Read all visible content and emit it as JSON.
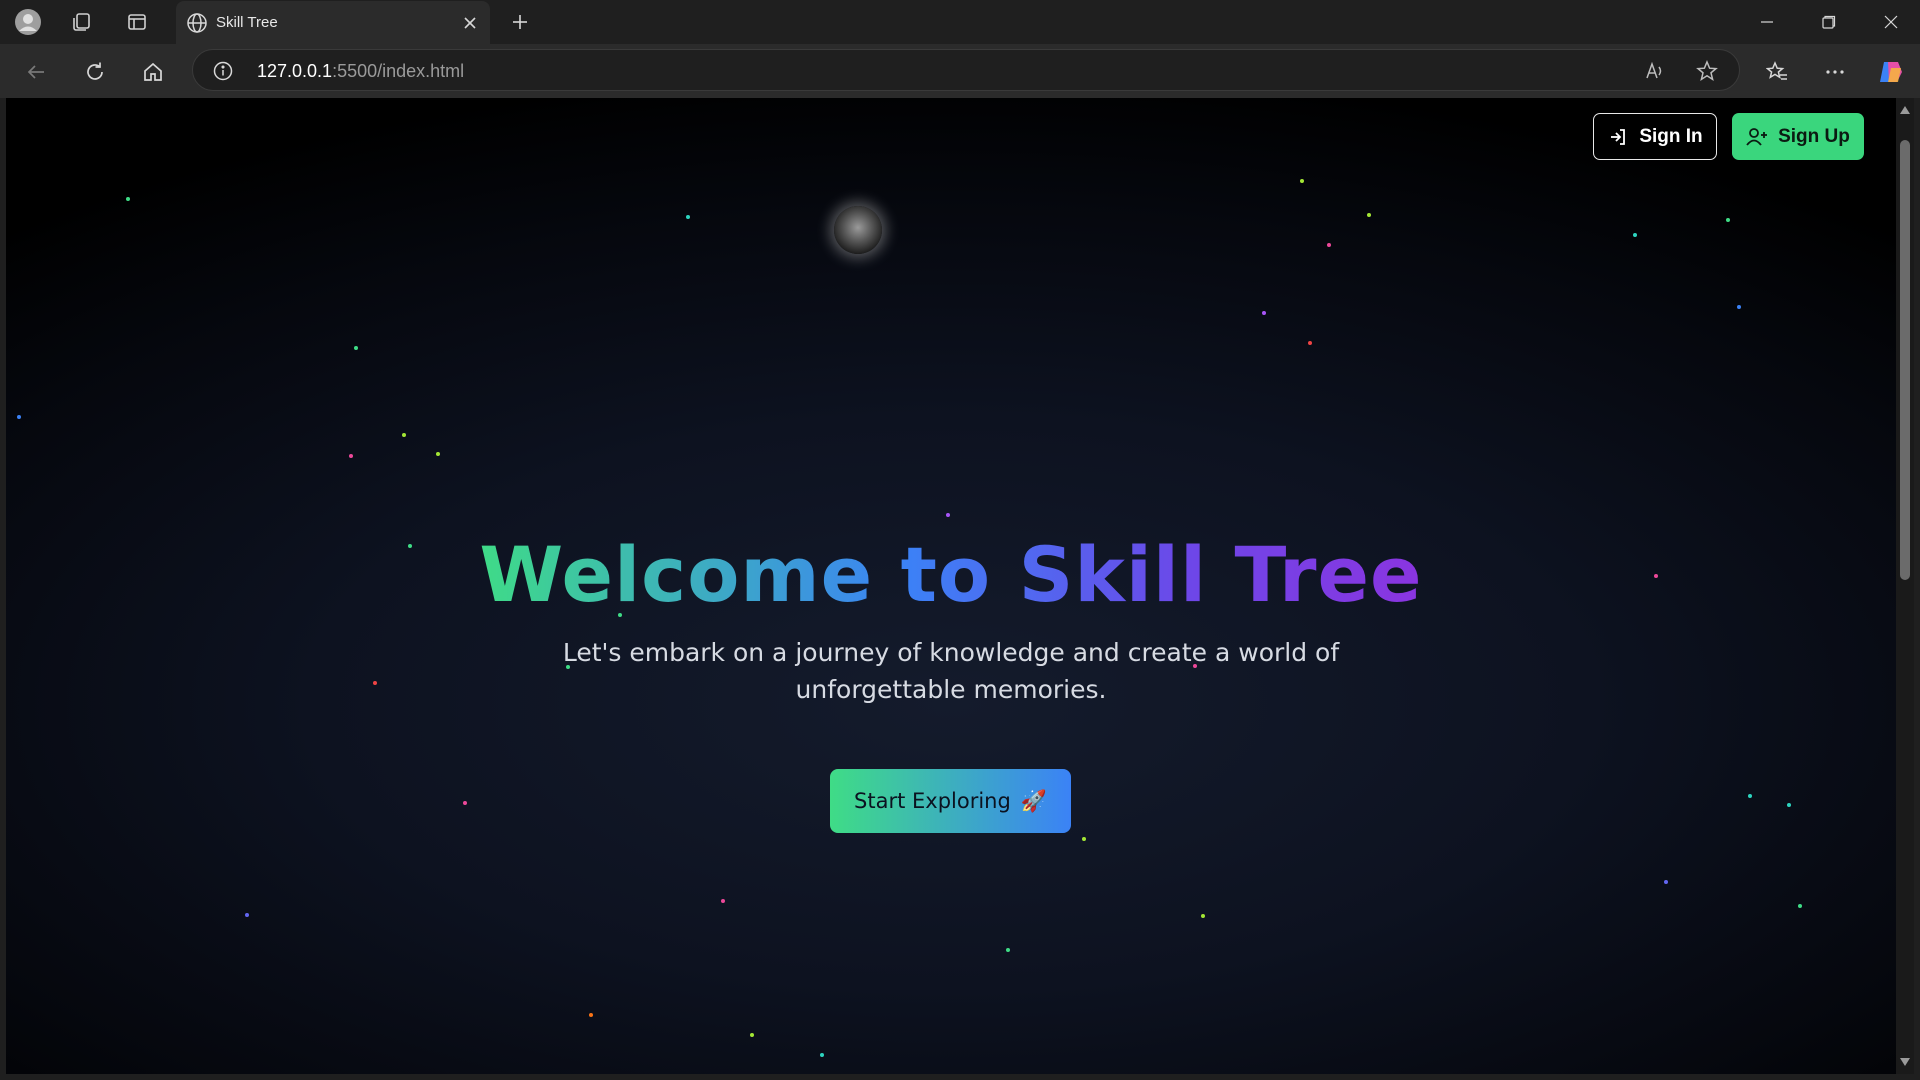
{
  "browser": {
    "tab_title": "Skill Tree",
    "url_host": "127.0.0.1",
    "url_rest": ":5500/index.html"
  },
  "icons": {
    "profile": "profile-avatar-icon",
    "workspaces": "workspaces-icon",
    "tab_actions": "tab-actions-icon",
    "tab_favicon": "globe-icon",
    "close_tab": "close-icon",
    "new_tab": "plus-icon",
    "minimize": "minimize-icon",
    "restore": "restore-icon",
    "close_window": "close-window-icon",
    "back": "back-arrow-icon",
    "refresh": "refresh-icon",
    "home": "home-icon",
    "site_info": "info-icon",
    "read_aloud": "read-aloud-icon",
    "favorite": "star-icon",
    "favorites": "favorites-icon",
    "more": "more-icon",
    "copilot": "copilot-icon",
    "sign_in": "sign-in-icon",
    "sign_up": "user-plus-icon",
    "rocket": "rocket-icon"
  },
  "page": {
    "sign_in_label": "Sign In",
    "sign_up_label": "Sign Up",
    "hero_title": "Welcome to Skill Tree",
    "hero_subtitle": "Let's embark on a journey of knowledge and create a world of unforgettable memories.",
    "cta_label": "Start Exploring",
    "cta_emoji": "🚀"
  },
  "colors": {
    "accent_green": "#3ad67d",
    "gradient_start": "#3fdc86",
    "gradient_mid": "#3b82f6",
    "gradient_end": "#8b34e0",
    "background": "#0d1220"
  }
}
